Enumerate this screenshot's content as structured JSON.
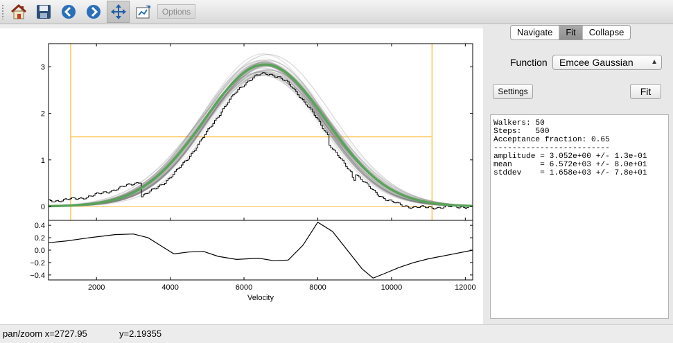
{
  "toolbar": {
    "buttons": [
      {
        "name": "home-icon",
        "active": false
      },
      {
        "name": "save-icon",
        "active": false
      },
      {
        "name": "back-arrow-icon",
        "active": false
      },
      {
        "name": "forward-arrow-icon",
        "active": false
      },
      {
        "name": "pan-move-icon",
        "active": true
      },
      {
        "name": "edit-options-icon",
        "active": false
      }
    ],
    "options_label": "Options"
  },
  "panel": {
    "tabs": [
      {
        "label": "Navigate",
        "active": false
      },
      {
        "label": "Fit",
        "active": true
      },
      {
        "label": "Collapse",
        "active": false
      }
    ],
    "function_label": "Function",
    "function_value": "Emcee Gaussian",
    "settings_label": "Settings",
    "fit_label": "Fit",
    "output_lines": [
      "Walkers: 50",
      "Steps:   500",
      "Acceptance fraction: 0.65",
      "-------------------------",
      "amplitude = 3.052e+00 +/- 1.3e-01",
      "mean      = 6.572e+03 +/- 8.0e+01",
      "stddev    = 1.658e+03 +/- 7.8e+01"
    ]
  },
  "status": {
    "mode_x": "pan/zoom x=2727.95",
    "y": "y=2.19355"
  },
  "colors": {
    "fit_line": "#5aa35a",
    "samples": "#777777",
    "window": "#ffd27a",
    "data": "#000000"
  },
  "chart_data": [
    {
      "type": "line",
      "xlim": [
        700,
        12200
      ],
      "ylim": [
        -0.3,
        3.5
      ],
      "yticks": [
        "0",
        "1",
        "2",
        "3"
      ],
      "window": {
        "x_min": 1300,
        "x_max": 11100,
        "level": 1.5
      },
      "series": [
        {
          "kind": "data-step",
          "values": "velocity spectrum (step histogram)"
        },
        {
          "kind": "fit",
          "amplitude": 3.052,
          "mean": 6572,
          "stddev": 1658
        }
      ]
    },
    {
      "type": "line",
      "xlim": [
        700,
        12200
      ],
      "ylim": [
        -0.48,
        0.48
      ],
      "yticks": [
        "0.4",
        "0.2",
        "0.0",
        "−0.2",
        "−0.4"
      ],
      "xticks": [
        "2000",
        "4000",
        "6000",
        "8000",
        "10000",
        "12000"
      ],
      "xlabel": "Velocity",
      "points": [
        [
          700,
          0.12
        ],
        [
          1200,
          0.15
        ],
        [
          1800,
          0.2
        ],
        [
          2500,
          0.25
        ],
        [
          3000,
          0.26
        ],
        [
          3400,
          0.2
        ],
        [
          3800,
          0.05
        ],
        [
          4100,
          -0.06
        ],
        [
          4500,
          -0.03
        ],
        [
          4900,
          -0.02
        ],
        [
          5300,
          -0.1
        ],
        [
          5800,
          -0.15
        ],
        [
          6400,
          -0.13
        ],
        [
          6800,
          -0.17
        ],
        [
          7200,
          -0.16
        ],
        [
          7600,
          0.08
        ],
        [
          8000,
          0.45
        ],
        [
          8400,
          0.3
        ],
        [
          8800,
          0.0
        ],
        [
          9200,
          -0.3
        ],
        [
          9500,
          -0.45
        ],
        [
          9800,
          -0.38
        ],
        [
          10200,
          -0.28
        ],
        [
          10600,
          -0.2
        ],
        [
          11000,
          -0.14
        ],
        [
          11600,
          -0.07
        ],
        [
          12200,
          0.0
        ]
      ]
    }
  ]
}
